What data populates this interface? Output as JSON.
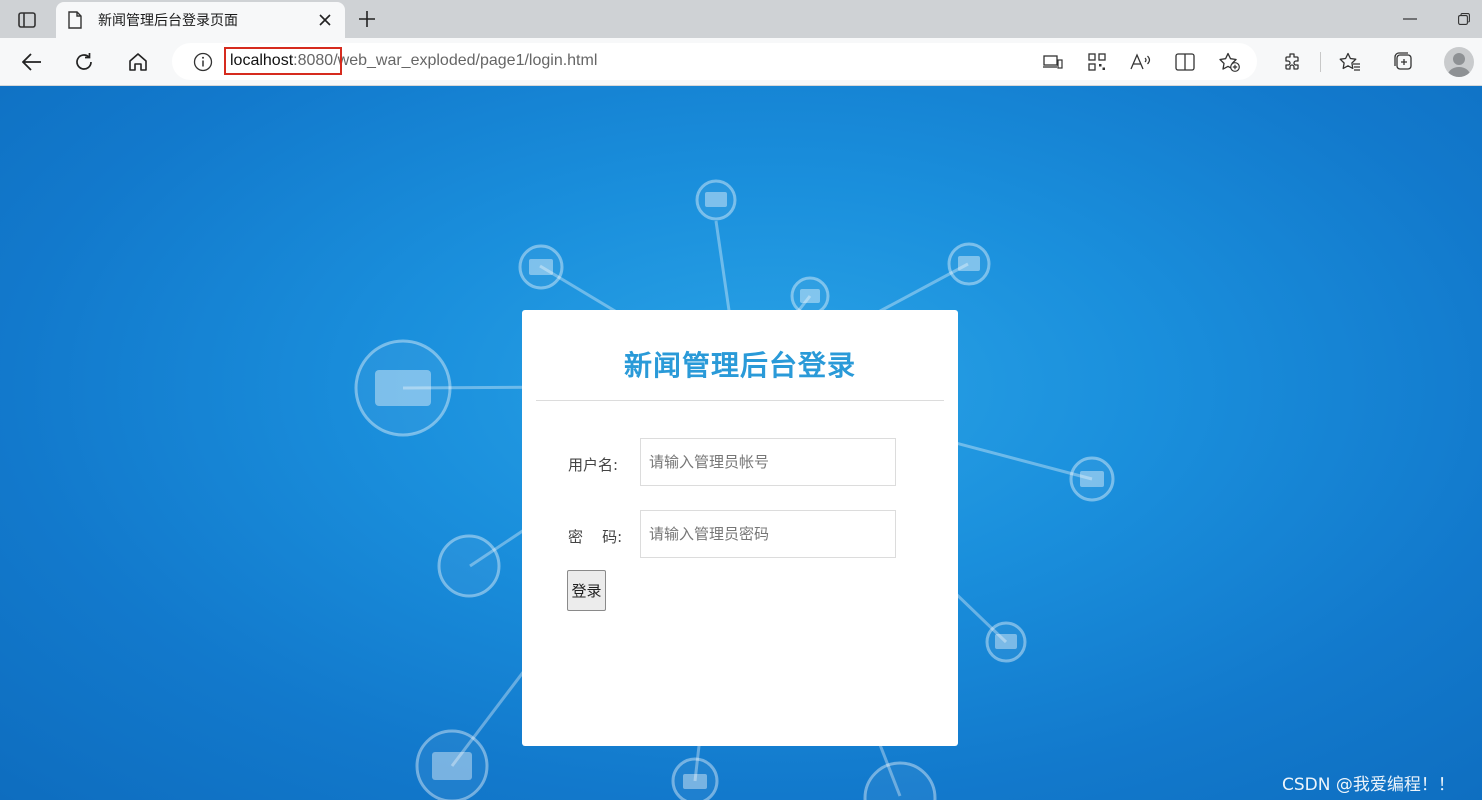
{
  "browser": {
    "tab": {
      "title": "新闻管理后台登录页面"
    },
    "url": {
      "host": "localhost",
      "port": ":8080",
      "path": "/web_war_exploded/page1/login.html"
    }
  },
  "login": {
    "title": "新闻管理后台登录",
    "username_label": "用户名:",
    "username_placeholder": "请输入管理员帐号",
    "password_label": "密    码:",
    "password_placeholder": "请输入管理员密码",
    "submit_label": "登录"
  },
  "watermark": "CSDN @我爱编程！！"
}
